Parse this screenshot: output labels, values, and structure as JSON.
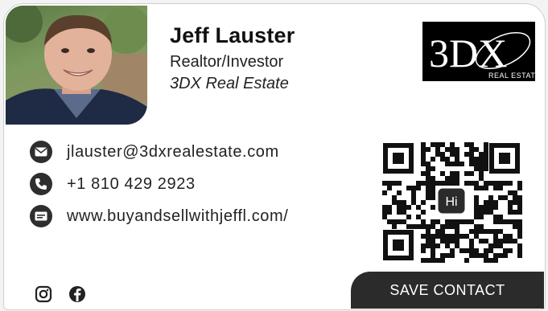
{
  "card": {
    "name": "Jeff Lauster",
    "title": "Realtor/Investor",
    "company": "3DX Real Estate"
  },
  "logo": {
    "main": "3DX",
    "sub": "REAL ESTATE"
  },
  "contacts": [
    {
      "icon": "mail-icon",
      "text": "jlauster@3dxrealestate.com"
    },
    {
      "icon": "phone-icon",
      "text": "+1 810 429 2923"
    },
    {
      "icon": "website-icon",
      "text": "www.buyandsellwithjeffl.com/"
    }
  ],
  "qr": {
    "center_label": "Hi"
  },
  "social": [
    {
      "icon": "instagram-icon"
    },
    {
      "icon": "facebook-icon"
    }
  ],
  "save_button": "SAVE CONTACT",
  "colors": {
    "button_bg": "#2b2b2b",
    "icon_bg": "#2e2e2e",
    "logo_bg": "#000000"
  }
}
